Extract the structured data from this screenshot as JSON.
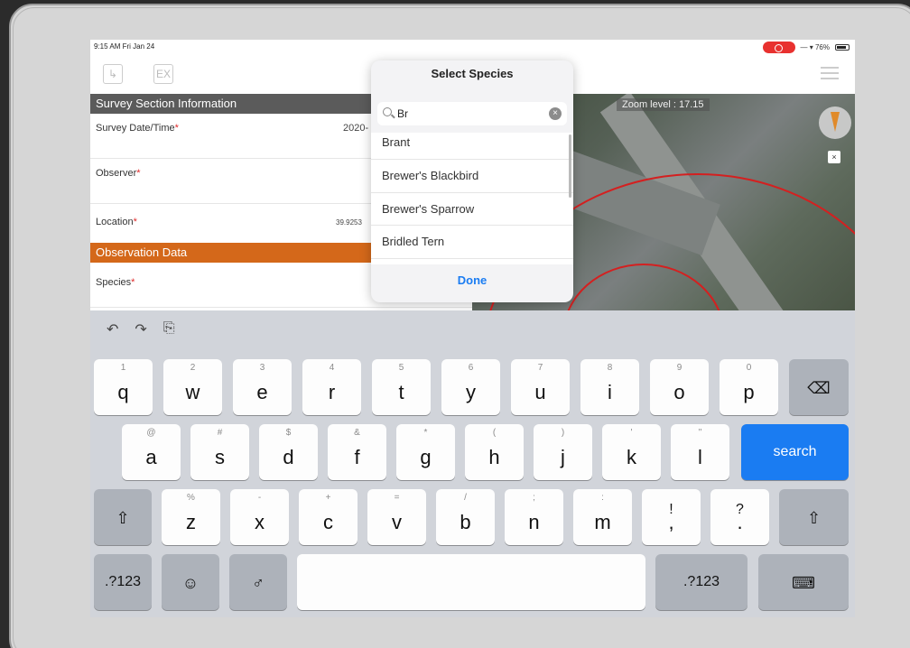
{
  "status_bar": {
    "time": "9:15 AM  Fri Jan 24",
    "right_text": "— ▾ 76%"
  },
  "toolbar": {
    "left_icon_1": "↳",
    "left_icon_2": "EX"
  },
  "form": {
    "section1_title": "Survey Section Information",
    "survey_date_label": "Survey Date/Time",
    "survey_date_value": "2020-",
    "observer_label": "Observer",
    "location_label": "Location",
    "location_value": "39.9253",
    "section2_title": "Observation Data",
    "species_label": "Species",
    "required_mark": "*"
  },
  "map": {
    "zoom_label": "Zoom level : 17.15",
    "close_icon": "×"
  },
  "species_popover": {
    "title": "Select Species",
    "search_value": "Br",
    "results": [
      "Brant",
      "Brewer's Blackbird",
      "Brewer's Sparrow",
      "Bridled Tern"
    ],
    "done_label": "Done"
  },
  "keyboard": {
    "tools": [
      "↶",
      "↷",
      "⎘"
    ],
    "row1": [
      {
        "hint": "1",
        "key": "q"
      },
      {
        "hint": "2",
        "key": "w"
      },
      {
        "hint": "3",
        "key": "e"
      },
      {
        "hint": "4",
        "key": "r"
      },
      {
        "hint": "5",
        "key": "t"
      },
      {
        "hint": "6",
        "key": "y"
      },
      {
        "hint": "7",
        "key": "u"
      },
      {
        "hint": "8",
        "key": "i"
      },
      {
        "hint": "9",
        "key": "o"
      },
      {
        "hint": "0",
        "key": "p"
      }
    ],
    "delete_symbol": "⌫",
    "row2": [
      {
        "hint": "@",
        "key": "a"
      },
      {
        "hint": "#",
        "key": "s"
      },
      {
        "hint": "$",
        "key": "d"
      },
      {
        "hint": "&",
        "key": "f"
      },
      {
        "hint": "*",
        "key": "g"
      },
      {
        "hint": "(",
        "key": "h"
      },
      {
        "hint": ")",
        "key": "j"
      },
      {
        "hint": "'",
        "key": "k"
      },
      {
        "hint": "\"",
        "key": "l"
      }
    ],
    "search_label": "search",
    "shift_symbol": "⇧",
    "row3": [
      {
        "hint": "%",
        "key": "z"
      },
      {
        "hint": "-",
        "key": "x"
      },
      {
        "hint": "+",
        "key": "c"
      },
      {
        "hint": "=",
        "key": "v"
      },
      {
        "hint": "/",
        "key": "b"
      },
      {
        "hint": ";",
        "key": "n"
      },
      {
        "hint": ":",
        "key": "m"
      },
      {
        "hint": "!",
        "key": ","
      },
      {
        "hint": "?",
        "key": "."
      }
    ],
    "numbers_label": ".?123",
    "emoji_symbol": "☺",
    "mic_symbol": "♂",
    "hide_keyboard_symbol": "⌨"
  }
}
